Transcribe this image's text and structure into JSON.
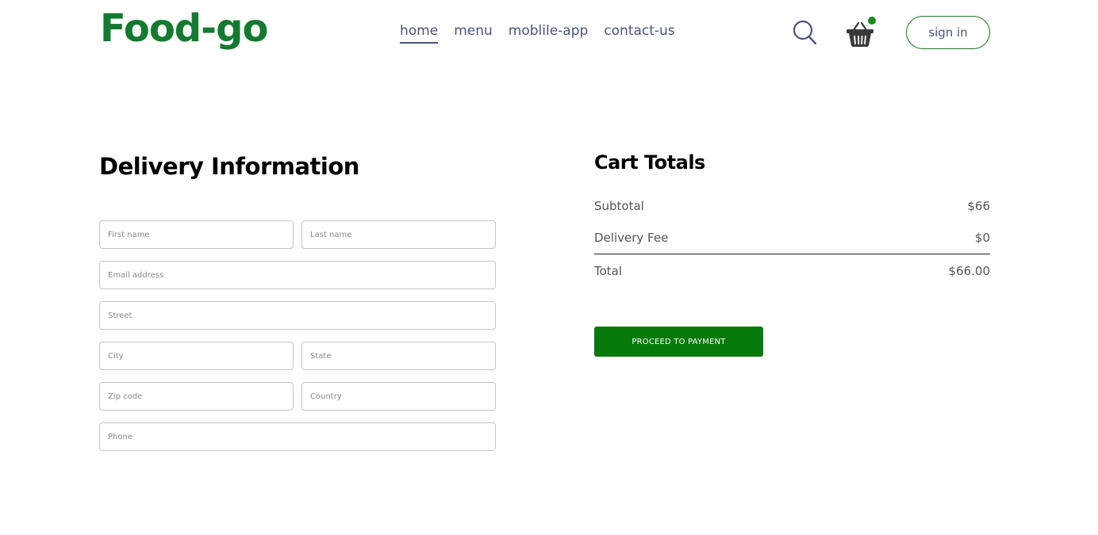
{
  "navbar": {
    "logo": "Food-go",
    "links": [
      {
        "label": "home",
        "active": true
      },
      {
        "label": "menu",
        "active": false
      },
      {
        "label": "moblile-app",
        "active": false
      },
      {
        "label": "contact-us",
        "active": false
      }
    ],
    "icons": {
      "search": "search-icon",
      "basket": "basket-icon"
    },
    "cart_has_items": true,
    "signin_label": "sign in"
  },
  "delivery": {
    "title": "Delivery Information",
    "fields": {
      "first_name": "First name",
      "last_name": "Last name",
      "email": "Email address",
      "street": "Street",
      "city": "City",
      "state": "State",
      "zip": "Zip code",
      "country": "Country",
      "phone": "Phone"
    }
  },
  "cart_totals": {
    "title": "Cart Totals",
    "subtotal_label": "Subtotal",
    "subtotal_value": "$66",
    "fee_label": "Delivery Fee",
    "fee_value": "$0",
    "total_label": "Total",
    "total_value": "$66.00",
    "proceed_label": "PROCEED TO PAYMENT"
  },
  "colors": {
    "brand_green": "#137a2f",
    "button_green": "#087a0c",
    "nav_text": "#49557e"
  }
}
